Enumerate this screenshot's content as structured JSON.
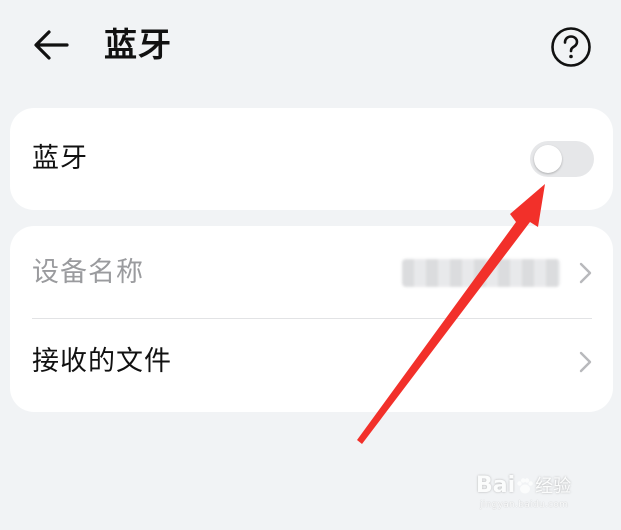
{
  "header": {
    "title": "蓝牙",
    "back_icon": "arrow-left-icon",
    "help_icon": "help-circle-icon"
  },
  "bluetooth_card": {
    "label": "蓝牙",
    "toggle_on": false
  },
  "list_card": {
    "items": [
      {
        "label": "设备名称",
        "value_redacted": true,
        "enabled": false,
        "icon": "chevron-right-icon"
      },
      {
        "label": "接收的文件",
        "enabled": true,
        "icon": "chevron-right-icon"
      }
    ]
  },
  "watermark": {
    "brand": "Bai",
    "suffix": "经验",
    "url": "jingyan.baidu.com"
  },
  "colors": {
    "background": "#f1f3f5",
    "card": "#ffffff",
    "text_primary": "#111111",
    "text_disabled": "#9a9b9e",
    "toggle_off": "#e6e7e9",
    "pointer_arrow": "#f2302a"
  }
}
